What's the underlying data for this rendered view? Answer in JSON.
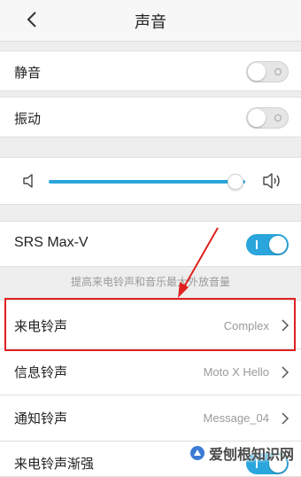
{
  "header": {
    "title": "声音",
    "back_icon": "chevron-left-icon"
  },
  "toggles": [
    {
      "label": "静音",
      "state": "off"
    },
    {
      "label": "振动",
      "state": "off"
    }
  ],
  "volume": {
    "level": 0.95,
    "low_icon": "speaker-low-icon",
    "high_icon": "speaker-high-icon"
  },
  "srs": {
    "label": "SRS Max-V",
    "state": "on",
    "description": "提高来电铃声和音乐最大外放音量"
  },
  "ringtones": [
    {
      "label": "来电铃声",
      "value": "Complex"
    },
    {
      "label": "信息铃声",
      "value": "Moto X Hello"
    },
    {
      "label": "通知铃声",
      "value": "Message_04"
    }
  ],
  "partial_row": {
    "label": "来电铃声渐强",
    "state": "on"
  },
  "watermark": {
    "text": "爱刨根知识网"
  },
  "colors": {
    "accent": "#2aa6dc",
    "highlight": "#e02020",
    "background": "#eeeeee"
  }
}
